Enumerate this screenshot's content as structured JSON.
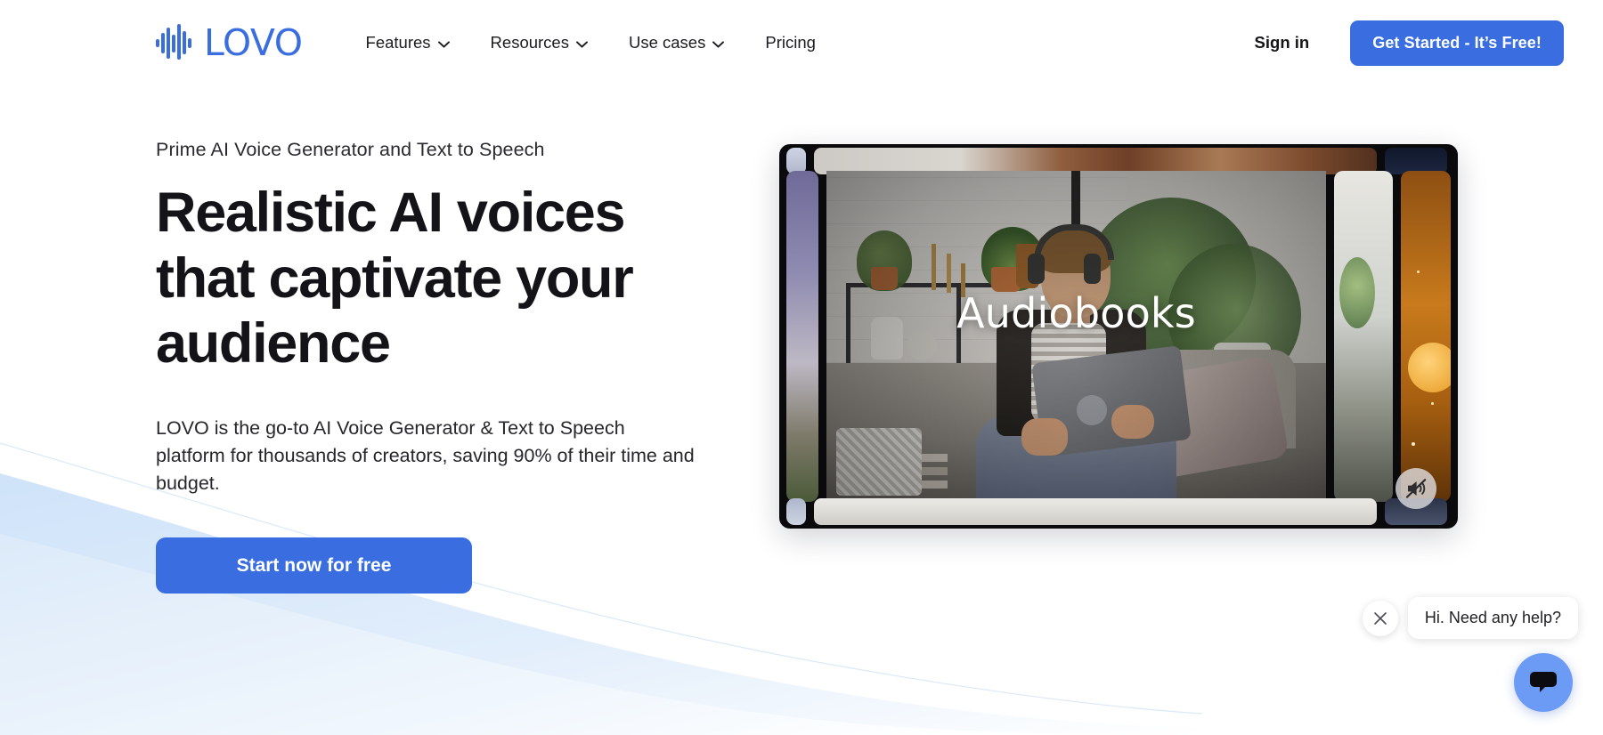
{
  "brand": {
    "name": "LOVO",
    "logo_icon": "audio-waveform-icon",
    "accent_color": "#3a6ee0"
  },
  "nav": {
    "items": [
      {
        "label": "Features",
        "has_dropdown": true,
        "icon": "chevron-down-icon"
      },
      {
        "label": "Resources",
        "has_dropdown": true,
        "icon": "chevron-down-icon"
      },
      {
        "label": "Use cases",
        "has_dropdown": true,
        "icon": "chevron-down-icon"
      },
      {
        "label": "Pricing",
        "has_dropdown": false,
        "icon": ""
      }
    ],
    "signin_label": "Sign in",
    "cta_label": "Get Started - It’s Free!"
  },
  "hero": {
    "eyebrow": "Prime AI Voice Generator and Text to Speech",
    "headline": "Realistic AI voices that captivate your audience",
    "subcopy": "LOVO is the go-to AI Voice Generator & Text to Speech platform for thousands of creators, saving 90% of their time and budget.",
    "cta_label": "Start now for free"
  },
  "media": {
    "caption": "Audiobooks",
    "mute_icon": "speaker-muted-icon",
    "mute_state": "muted"
  },
  "chat": {
    "message": "Hi. Need any help?",
    "close_icon": "close-icon",
    "launcher_icon": "chat-bubble-icon",
    "launcher_color": "#6c9bf5"
  }
}
